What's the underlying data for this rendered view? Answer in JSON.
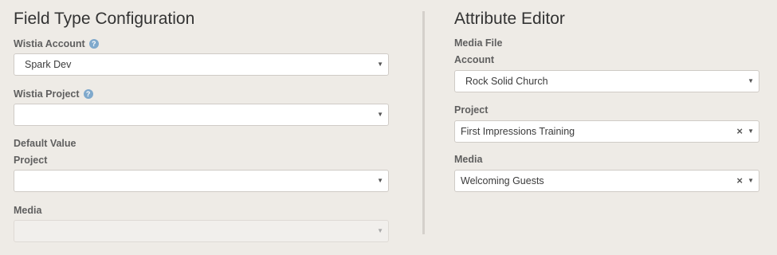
{
  "field_type": {
    "title": "Field Type Configuration",
    "account_label": "Wistia Account",
    "account_value": "Spark Dev",
    "project_label": "Wistia Project",
    "project_value": "",
    "default_value_label": "Default Value",
    "default_project_label": "Project",
    "default_project_value": "",
    "default_media_label": "Media",
    "default_media_value": "",
    "help_glyph": "?"
  },
  "attribute_editor": {
    "title": "Attribute Editor",
    "media_file_label": "Media File",
    "account_label": "Account",
    "account_value": "Rock Solid Church",
    "project_label": "Project",
    "project_value": "First Impressions Training",
    "media_label": "Media",
    "media_value": "Welcoming Guests"
  },
  "icons": {
    "dropdown": "chevron-down-icon",
    "clear": "clear-icon",
    "help": "help-icon"
  },
  "glyphs": {
    "arrow": "▼",
    "clear": "×"
  },
  "colors": {
    "background": "#eeebe6",
    "help_icon": "#7fa9cc",
    "divider": "#d4d0cb"
  }
}
